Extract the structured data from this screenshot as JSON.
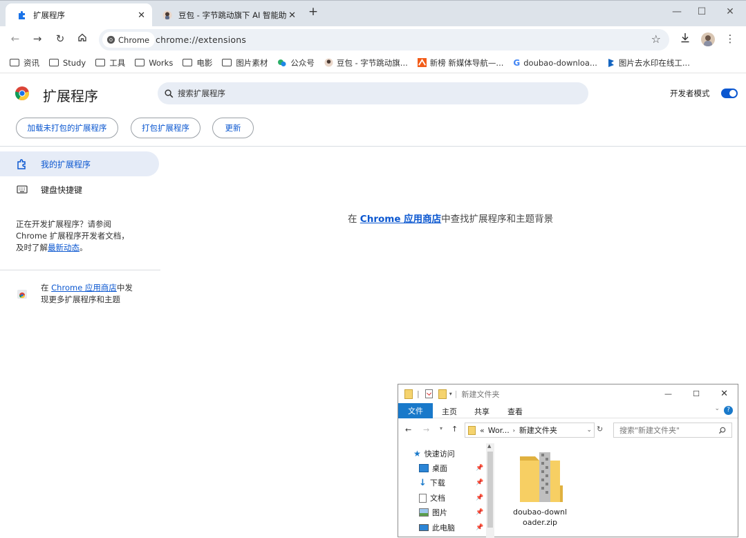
{
  "window": {
    "tabs": [
      {
        "title": "扩展程序",
        "active": true,
        "icon": "puzzle-icon"
      },
      {
        "title": "豆包 - 字节跳动旗下 AI 智能助",
        "active": false,
        "icon": "doubao-avatar-icon"
      }
    ],
    "new_tab_symbol": "+",
    "controls": {
      "minimize": "—",
      "maximize": "☐",
      "close": "✕"
    }
  },
  "toolbar": {
    "chip_label": "Chrome",
    "url": "chrome://extensions"
  },
  "bookmarks": [
    {
      "label": "资讯",
      "icon": "folder-icon"
    },
    {
      "label": "Study",
      "icon": "folder-icon"
    },
    {
      "label": "工具",
      "icon": "folder-icon"
    },
    {
      "label": "Works",
      "icon": "folder-icon"
    },
    {
      "label": "电影",
      "icon": "folder-icon"
    },
    {
      "label": "图片素材",
      "icon": "folder-icon"
    },
    {
      "label": "公众号",
      "icon": "wechat-icon"
    },
    {
      "label": "豆包 - 字节跳动旗...",
      "icon": "doubao-avatar-icon"
    },
    {
      "label": "新榜 新媒体导航—...",
      "icon": "newrank-icon"
    },
    {
      "label": "doubao-downloa...",
      "icon": "google-icon"
    },
    {
      "label": "图片去水印在线工...",
      "icon": "bookmark-site-icon"
    }
  ],
  "page": {
    "title": "扩展程序",
    "search_placeholder": "搜索扩展程序",
    "dev_mode_label": "开发者模式",
    "dev_mode_on": true,
    "buttons": {
      "load_unpacked": "加载未打包的扩展程序",
      "pack": "打包扩展程序",
      "update": "更新"
    },
    "nav": {
      "my_extensions": "我的扩展程序",
      "shortcuts": "键盘快捷键"
    },
    "dev_info": {
      "text1": "正在开发扩展程序？请参阅",
      "text2": "Chrome 扩展程序开发者文档，",
      "text3": "及时了解",
      "link": "最新动态",
      "text4": "。"
    },
    "store_info": {
      "text1": "在 ",
      "link": "Chrome 应用商店",
      "text2": "中发",
      "text3": "现更多扩展程序和主题"
    },
    "empty_message": {
      "pre": "在 ",
      "link": "Chrome 应用商店",
      "post": "中查找扩展程序和主题背景"
    }
  },
  "explorer": {
    "title": "新建文件夹",
    "ribbon_tabs": [
      "文件",
      "主页",
      "共享",
      "查看"
    ],
    "path_prefix": "«",
    "path_parts": [
      "Wor...",
      "新建文件夹"
    ],
    "search_placeholder": "搜索\"新建文件夹\"",
    "nav_items": [
      {
        "label": "快速访问",
        "icon": "star-icon"
      },
      {
        "label": "桌面",
        "icon": "desktop-icon"
      },
      {
        "label": "下载",
        "icon": "download-arrow-icon"
      },
      {
        "label": "文档",
        "icon": "document-icon"
      },
      {
        "label": "图片",
        "icon": "picture-icon"
      },
      {
        "label": "此电脑",
        "icon": "computer-icon"
      }
    ],
    "file": {
      "name_line1": "doubao-downl",
      "name_line2": "oader.zip",
      "icon": "zip-folder-icon"
    }
  }
}
